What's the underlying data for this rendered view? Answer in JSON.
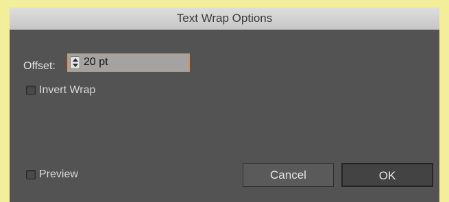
{
  "dialog": {
    "title": "Text Wrap Options"
  },
  "offset": {
    "label": "Offset:",
    "value": "20 pt"
  },
  "invert_wrap": {
    "label": "Invert Wrap",
    "checked": false
  },
  "preview": {
    "label": "Preview",
    "checked": false
  },
  "buttons": {
    "cancel": "Cancel",
    "ok": "OK"
  },
  "colors": {
    "dialog_bg": "#535353",
    "focus_border": "#f08c2c",
    "window_bg": "#f3ee9a"
  }
}
